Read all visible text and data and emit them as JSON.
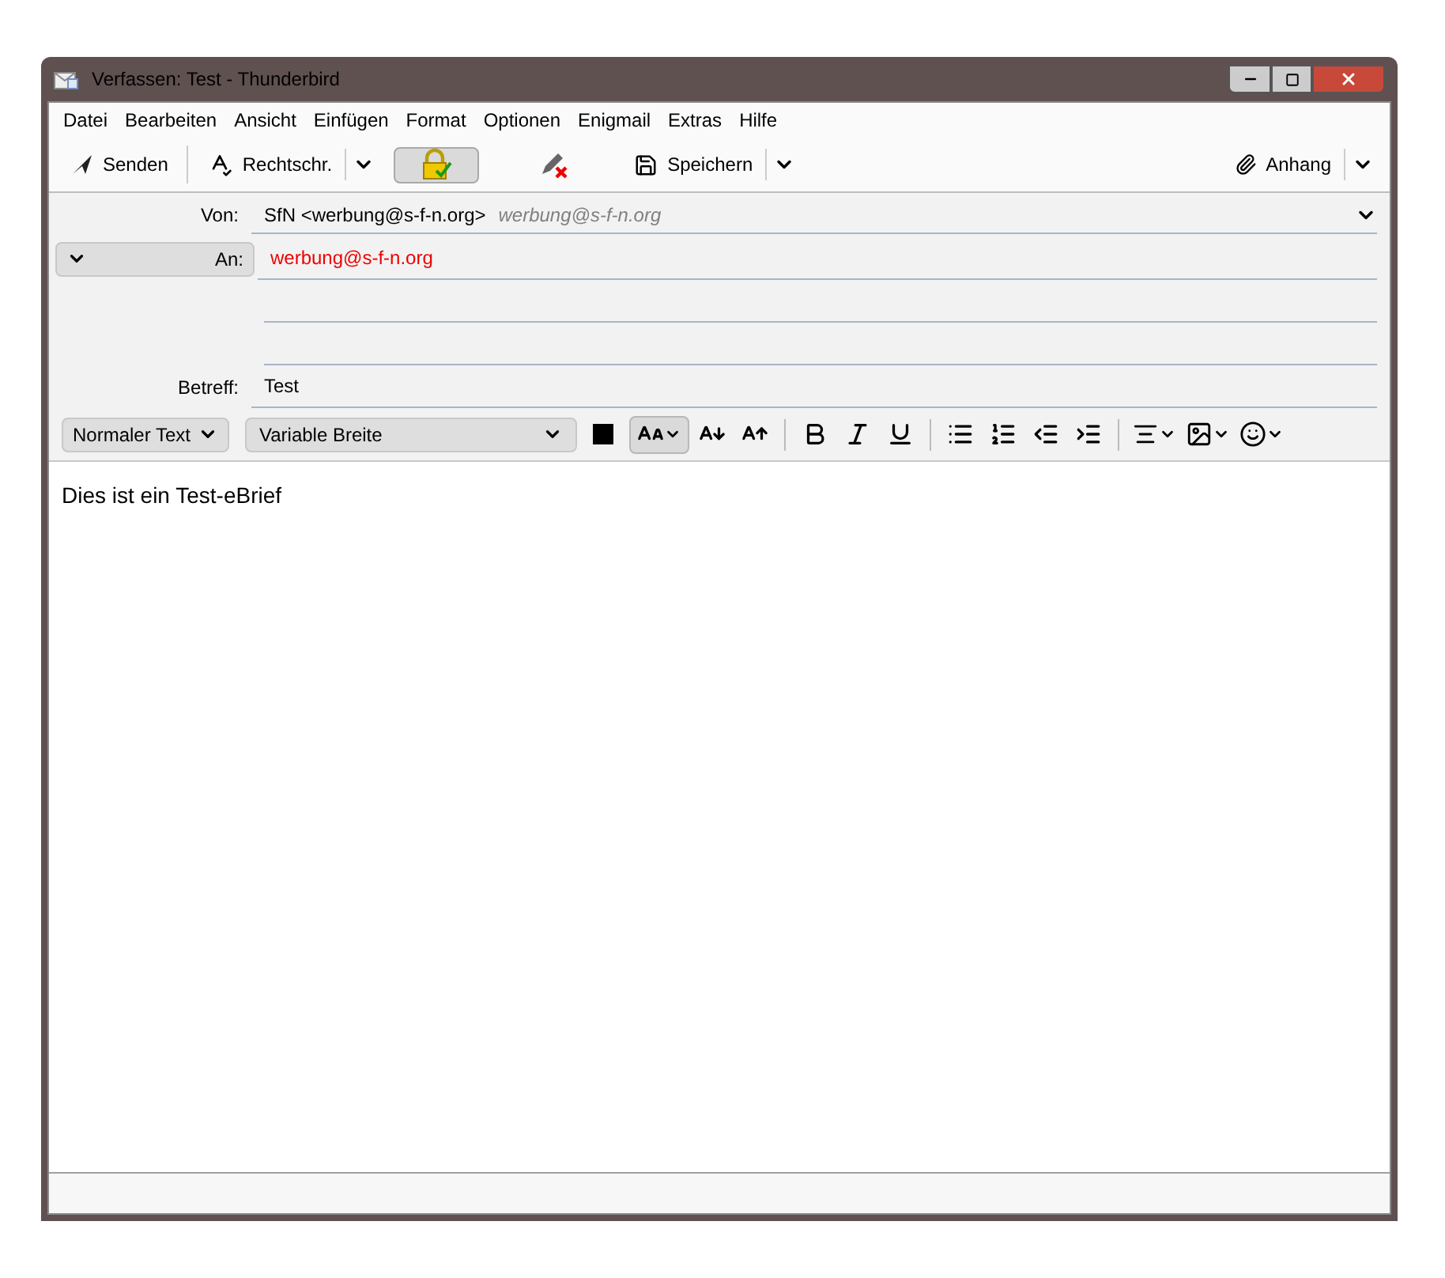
{
  "window": {
    "title": "Verfassen: Test - Thunderbird"
  },
  "menu": [
    "Datei",
    "Bearbeiten",
    "Ansicht",
    "Einfügen",
    "Format",
    "Optionen",
    "Enigmail",
    "Extras",
    "Hilfe"
  ],
  "toolbar": [
    {
      "kind": "button",
      "label": "Senden"
    },
    {
      "kind": "split",
      "label": "Rechtschr."
    },
    {
      "kind": "toggle",
      "pressed": true
    },
    {
      "kind": "toggle",
      "pressed": false
    },
    {
      "kind": "split",
      "label": "Speichern"
    }
  ],
  "attach_button": {
    "label": "Anhang"
  },
  "header": {
    "from_label": "Von:",
    "from_value": "SfN <werbung@s-f-n.org>",
    "from_identity": "werbung@s-f-n.org",
    "recipients": [
      {
        "type_label": "An:",
        "address": "werbung@s-f-n.org",
        "color": "#ee0000"
      }
    ],
    "subject_label": "Betreff:",
    "subject": "Test"
  },
  "format_toolbar": {
    "paragraph": "Normaler Text",
    "font": "Variable Breite",
    "size_pressed": true
  },
  "body": {
    "text": "Dies ist ein Test-eBrief"
  }
}
